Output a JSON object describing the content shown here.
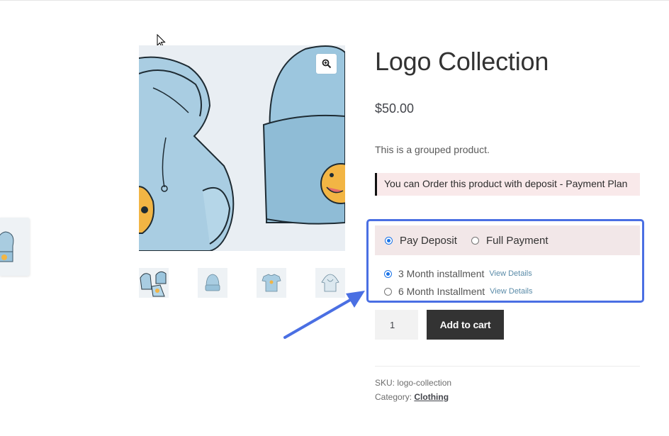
{
  "product": {
    "title": "Logo Collection",
    "price": "$50.00",
    "description": "This is a grouped product.",
    "deposit_notice": "You can Order this product with deposit - Payment Plan"
  },
  "payment_options": {
    "deposit_label": "Pay Deposit",
    "full_label": "Full Payment",
    "selected": "deposit"
  },
  "payment_plans": [
    {
      "label": "3 Month installment",
      "details_link": "View Details",
      "selected": true
    },
    {
      "label": "6 Month Installment",
      "details_link": "View Details",
      "selected": false
    }
  ],
  "cart": {
    "quantity": "1",
    "add_label": "Add to cart"
  },
  "meta": {
    "sku_label": "SKU:",
    "sku_value": "logo-collection",
    "category_label": "Category:",
    "category_value": "Clothing"
  },
  "gallery": {
    "thumbnails": [
      "logo-collection-icon",
      "beanie-icon",
      "tshirt-icon",
      "hoodie-icon"
    ],
    "zoom_icon": "magnifier-plus-icon"
  },
  "colors": {
    "highlight": "#4a6fe3",
    "radio_accent": "#1a73e8",
    "notice_bg": "#f9e9ea",
    "button_bg": "#333333"
  }
}
